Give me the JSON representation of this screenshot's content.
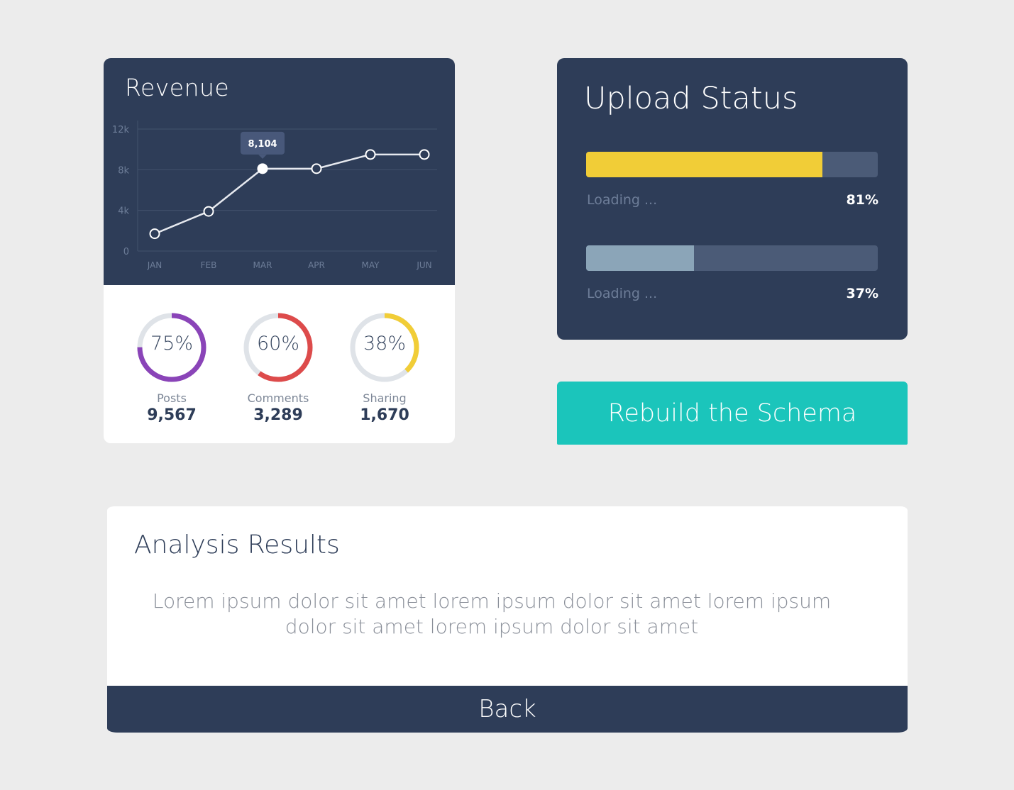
{
  "revenue": {
    "title": "Revenue",
    "tooltip": "8,104",
    "colors": {
      "panel": "#2e3d58",
      "grid": "#43526d",
      "line": "#e6e9ef",
      "tick": "#6d7d98"
    }
  },
  "chart_data": {
    "type": "line",
    "title": "Revenue",
    "categories": [
      "JAN",
      "FEB",
      "MAR",
      "APR",
      "MAY",
      "JUN"
    ],
    "values": [
      1700,
      3900,
      8104,
      8104,
      9500,
      9500
    ],
    "yticks": [
      "0",
      "4k",
      "8k",
      "12k"
    ],
    "ylim": [
      0,
      12000
    ],
    "highlight_index": 2,
    "grid": true
  },
  "stats": [
    {
      "percent_label": "75%",
      "percent": 75,
      "label": "Posts",
      "value": "9,567",
      "color": "#8a44b8"
    },
    {
      "percent_label": "60%",
      "percent": 60,
      "label": "Comments",
      "value": "3,289",
      "color": "#dd4b4b"
    },
    {
      "percent_label": "38%",
      "percent": 38,
      "label": "Sharing",
      "value": "1,670",
      "color": "#f1cd37"
    }
  ],
  "upload": {
    "title": "Upload Status",
    "bars": [
      {
        "label": "Loading ...",
        "percent_label": "81%",
        "percent": 81,
        "color": "#f1cd37"
      },
      {
        "label": "Loading ...",
        "percent_label": "37%",
        "percent": 37,
        "color": "#8ba5b8"
      }
    ]
  },
  "rebuild_button": {
    "label": "Rebuild the Schema"
  },
  "analysis": {
    "title": "Analysis Results",
    "body": "Lorem ipsum dolor sit amet lorem ipsum dolor sit amet lorem ipsum dolor sit amet lorem ipsum dolor sit amet",
    "back_label": "Back"
  }
}
